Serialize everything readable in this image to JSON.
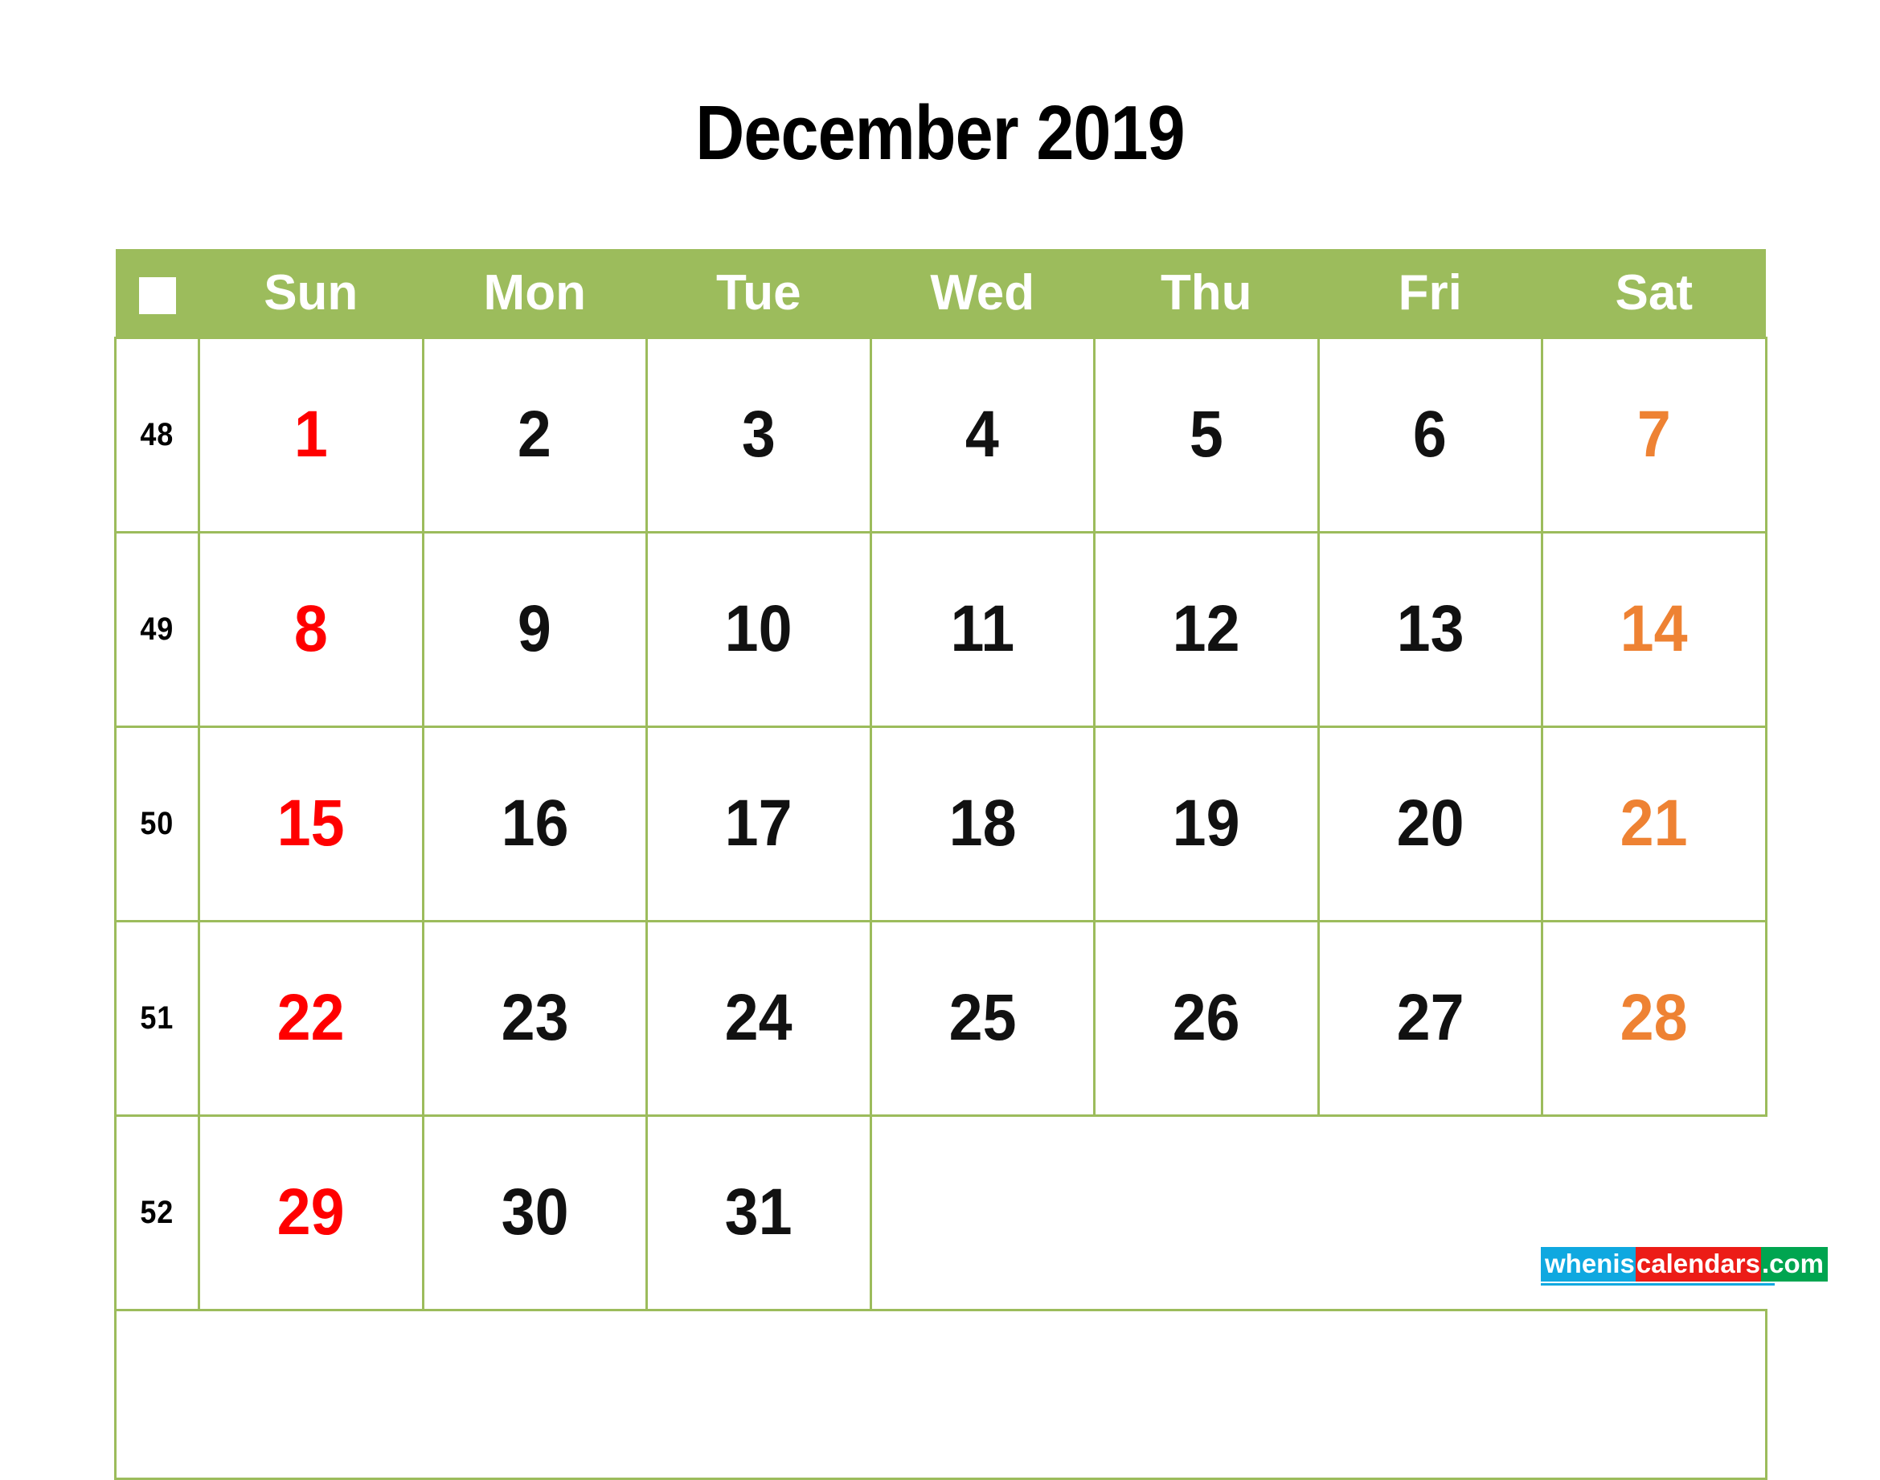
{
  "title": "December 2019",
  "colors": {
    "header_bg": "#9cbc5c",
    "grid_line": "#9cbc5c",
    "sunday": "#ff0000",
    "saturday": "#ee8233",
    "weekday": "#111111",
    "header_text": "#ffffff"
  },
  "header": {
    "week_col_icon": "white-square-icon",
    "days": [
      "Sun",
      "Mon",
      "Tue",
      "Wed",
      "Thu",
      "Fri",
      "Sat"
    ]
  },
  "weeks": [
    {
      "week_number": "48",
      "days": [
        {
          "label": "1",
          "kind": "sun"
        },
        {
          "label": "2",
          "kind": "weekday"
        },
        {
          "label": "3",
          "kind": "weekday"
        },
        {
          "label": "4",
          "kind": "weekday"
        },
        {
          "label": "5",
          "kind": "weekday"
        },
        {
          "label": "6",
          "kind": "weekday"
        },
        {
          "label": "7",
          "kind": "sat"
        }
      ]
    },
    {
      "week_number": "49",
      "days": [
        {
          "label": "8",
          "kind": "sun"
        },
        {
          "label": "9",
          "kind": "weekday"
        },
        {
          "label": "10",
          "kind": "weekday"
        },
        {
          "label": "11",
          "kind": "weekday"
        },
        {
          "label": "12",
          "kind": "weekday"
        },
        {
          "label": "13",
          "kind": "weekday"
        },
        {
          "label": "14",
          "kind": "sat"
        }
      ]
    },
    {
      "week_number": "50",
      "days": [
        {
          "label": "15",
          "kind": "sun"
        },
        {
          "label": "16",
          "kind": "weekday"
        },
        {
          "label": "17",
          "kind": "weekday"
        },
        {
          "label": "18",
          "kind": "weekday"
        },
        {
          "label": "19",
          "kind": "weekday"
        },
        {
          "label": "20",
          "kind": "weekday"
        },
        {
          "label": "21",
          "kind": "sat"
        }
      ]
    },
    {
      "week_number": "51",
      "days": [
        {
          "label": "22",
          "kind": "sun"
        },
        {
          "label": "23",
          "kind": "weekday"
        },
        {
          "label": "24",
          "kind": "weekday"
        },
        {
          "label": "25",
          "kind": "weekday"
        },
        {
          "label": "26",
          "kind": "weekday"
        },
        {
          "label": "27",
          "kind": "weekday"
        },
        {
          "label": "28",
          "kind": "sat"
        }
      ]
    },
    {
      "week_number": "52",
      "days": [
        {
          "label": "29",
          "kind": "sun"
        },
        {
          "label": "30",
          "kind": "weekday"
        },
        {
          "label": "31",
          "kind": "weekday"
        },
        {
          "label": "",
          "kind": "blank"
        },
        {
          "label": "",
          "kind": "blank"
        },
        {
          "label": "",
          "kind": "blank"
        },
        {
          "label": "",
          "kind": "blank"
        }
      ]
    }
  ],
  "logo": {
    "part1": "whenis",
    "part2": "calendars",
    "part3": ".com",
    "part1_color": "#0fa8e0",
    "part2_color": "#ec1c17",
    "part3_color": "#00a550"
  }
}
